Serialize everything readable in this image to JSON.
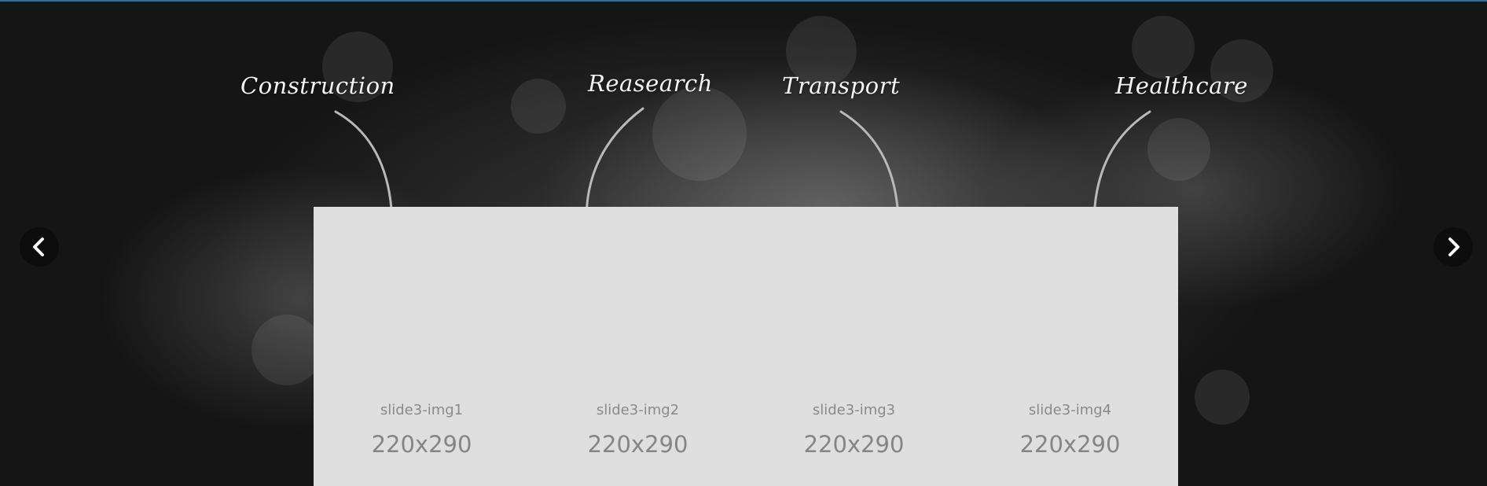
{
  "categories": [
    {
      "label": "Construction"
    },
    {
      "label": "Reasearch"
    },
    {
      "label": "Transport"
    },
    {
      "label": "Healthcare"
    }
  ],
  "slides": [
    {
      "name": "slide3-img1",
      "size": "220x290"
    },
    {
      "name": "slide3-img2",
      "size": "220x290"
    },
    {
      "name": "slide3-img3",
      "size": "220x290"
    },
    {
      "name": "slide3-img4",
      "size": "220x290"
    }
  ],
  "navigation": {
    "prev_icon": "chevron-left-icon",
    "next_icon": "chevron-right-icon"
  },
  "colors": {
    "panel": "#dfdfdf",
    "label_text": "#f4f4f4",
    "placeholder_text": "#8a8a8a",
    "nav_button": "#0c0c0c",
    "accent_top_line": "#2f6f8c"
  }
}
